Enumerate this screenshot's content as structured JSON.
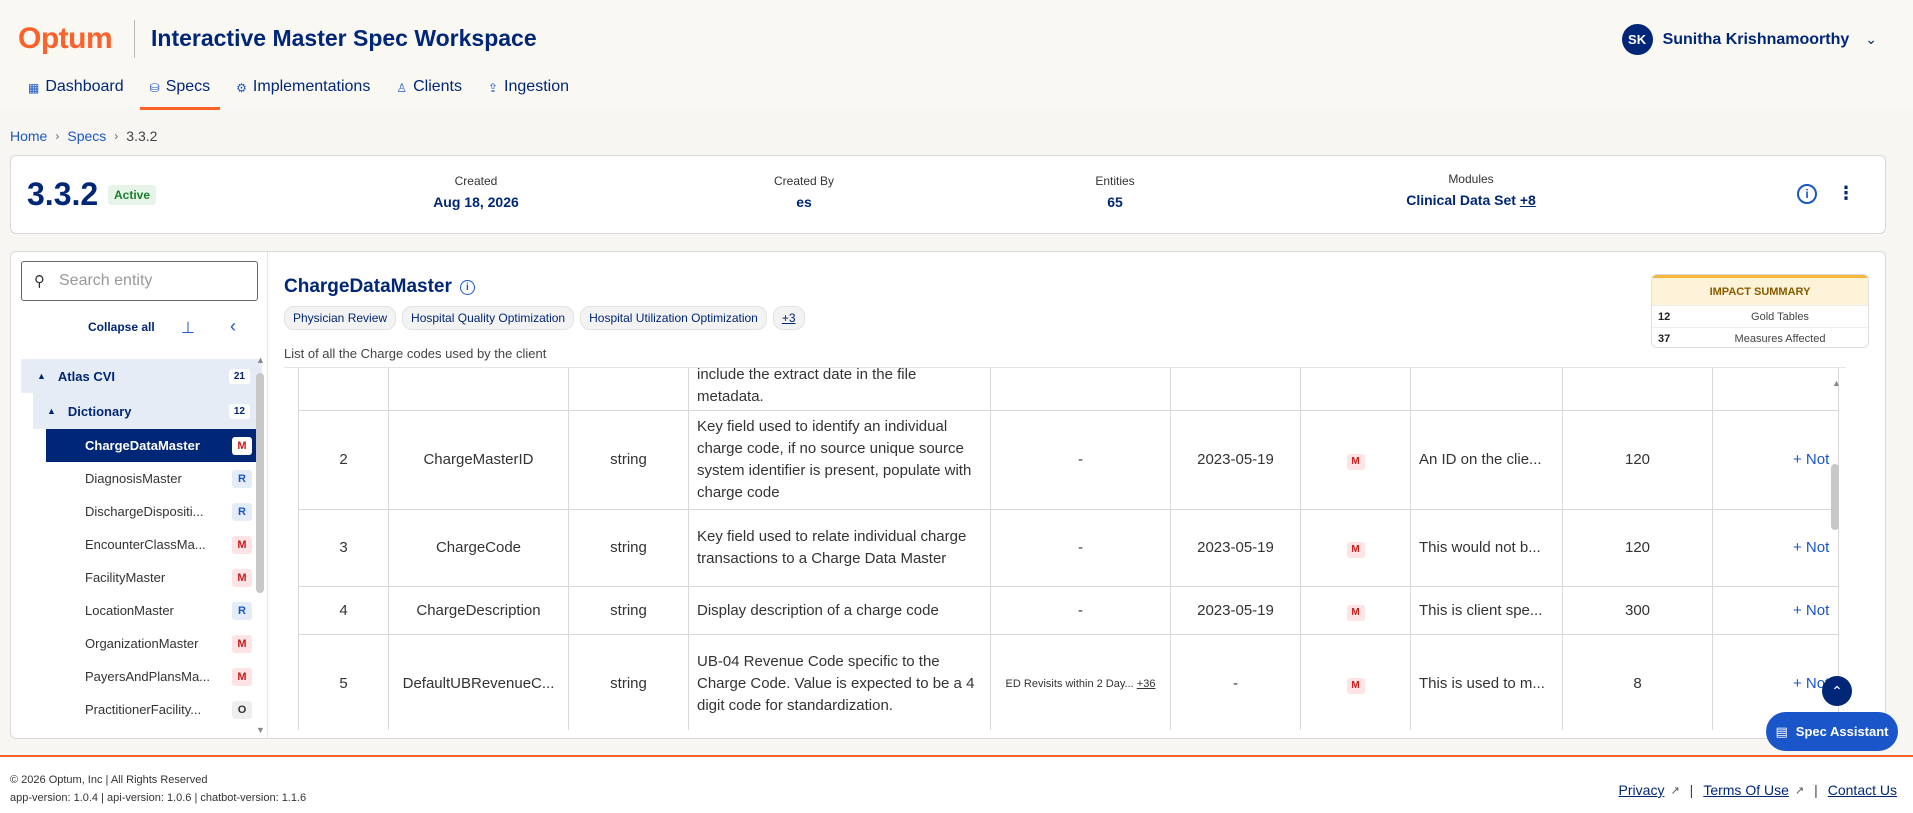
{
  "header": {
    "logo": "Optum",
    "app_title": "Interactive Master Spec Workspace",
    "user": {
      "initials": "SK",
      "name": "Sunitha Krishnamoorthy"
    },
    "nav": [
      {
        "label": "Dashboard",
        "icon": "grid-icon"
      },
      {
        "label": "Specs",
        "icon": "database-icon",
        "active": true
      },
      {
        "label": "Implementations",
        "icon": "gear-icon"
      },
      {
        "label": "Clients",
        "icon": "person-icon"
      },
      {
        "label": "Ingestion",
        "icon": "upload-icon"
      }
    ]
  },
  "breadcrumb": [
    "Home",
    "Specs",
    "3.3.2"
  ],
  "spec": {
    "version": "3.3.2",
    "status": "Active",
    "created_label": "Created",
    "created": "Aug 18, 2026",
    "created_by_label": "Created By",
    "created_by": "es",
    "entities_label": "Entities",
    "entities": "65",
    "modules_label": "Modules",
    "modules": "Clinical Data Set",
    "modules_more": "+8"
  },
  "sidebar": {
    "search_placeholder": "Search entity",
    "collapse_all": "Collapse all",
    "group": {
      "label": "Atlas CVI",
      "count": "21"
    },
    "subgroup": {
      "label": "Dictionary",
      "count": "12"
    },
    "items": [
      {
        "label": "ChargeDataMaster",
        "badge": "M",
        "selected": true
      },
      {
        "label": "DiagnosisMaster",
        "badge": "R"
      },
      {
        "label": "DischargeDispositi...",
        "badge": "R"
      },
      {
        "label": "EncounterClassMa...",
        "badge": "M"
      },
      {
        "label": "FacilityMaster",
        "badge": "M"
      },
      {
        "label": "LocationMaster",
        "badge": "R"
      },
      {
        "label": "OrganizationMaster",
        "badge": "M"
      },
      {
        "label": "PayersAndPlansMa...",
        "badge": "M"
      },
      {
        "label": "PractitionerFacility...",
        "badge": "O"
      }
    ]
  },
  "entity": {
    "name": "ChargeDataMaster",
    "tags": [
      "Physician Review",
      "Hospital Quality Optimization",
      "Hospital Utilization Optimization"
    ],
    "tags_more": "+3",
    "description": "List of all the Charge codes used by the client"
  },
  "impact": {
    "title": "IMPACT SUMMARY",
    "rows": [
      {
        "count": "12",
        "label": "Gold Tables"
      },
      {
        "count": "37",
        "label": "Measures Affected"
      }
    ]
  },
  "table": {
    "partial_row": {
      "desc": "include the extract date in the file metadata."
    },
    "rows": [
      {
        "num": "2",
        "field": "ChargeMasterID",
        "type": "string",
        "desc": "Key field used to identify an individual charge code, if no source unique source system identifier is present, populate with charge code",
        "measures": "-",
        "measures_more": "",
        "date": "2023-05-19",
        "req": "M",
        "example": "An ID on the clie...",
        "length": "120",
        "notes": "+ Not"
      },
      {
        "num": "3",
        "field": "ChargeCode",
        "type": "string",
        "desc": "Key field used to relate individual charge transactions to a Charge Data Master",
        "measures": "-",
        "measures_more": "",
        "date": "2023-05-19",
        "req": "M",
        "example": "This would not b...",
        "length": "120",
        "notes": "+ Not"
      },
      {
        "num": "4",
        "field": "ChargeDescription",
        "type": "string",
        "desc": "Display description of a charge code",
        "measures": "-",
        "measures_more": "",
        "date": "2023-05-19",
        "req": "M",
        "example": "This is client spe...",
        "length": "300",
        "notes": "+ Not"
      },
      {
        "num": "5",
        "field": "DefaultUBRevenueC...",
        "type": "string",
        "desc": "UB-04 Revenue Code specific to the Charge Code. Value is expected to be a 4 digit code for standardization.",
        "measures": "ED Revisits within 2 Day...",
        "measures_more": "+36",
        "date": "-",
        "req": "M",
        "example": "This is used to m...",
        "length": "8",
        "notes": "+ Not"
      }
    ]
  },
  "assistant_label": "Spec Assistant",
  "footer": {
    "copyright": "© 2026 Optum, Inc | All Rights Reserved",
    "versions": "app-version: 1.0.4 | api-version: 1.0.6 | chatbot-version: 1.1.6",
    "links": [
      "Privacy",
      "Terms Of Use",
      "Contact Us"
    ]
  }
}
